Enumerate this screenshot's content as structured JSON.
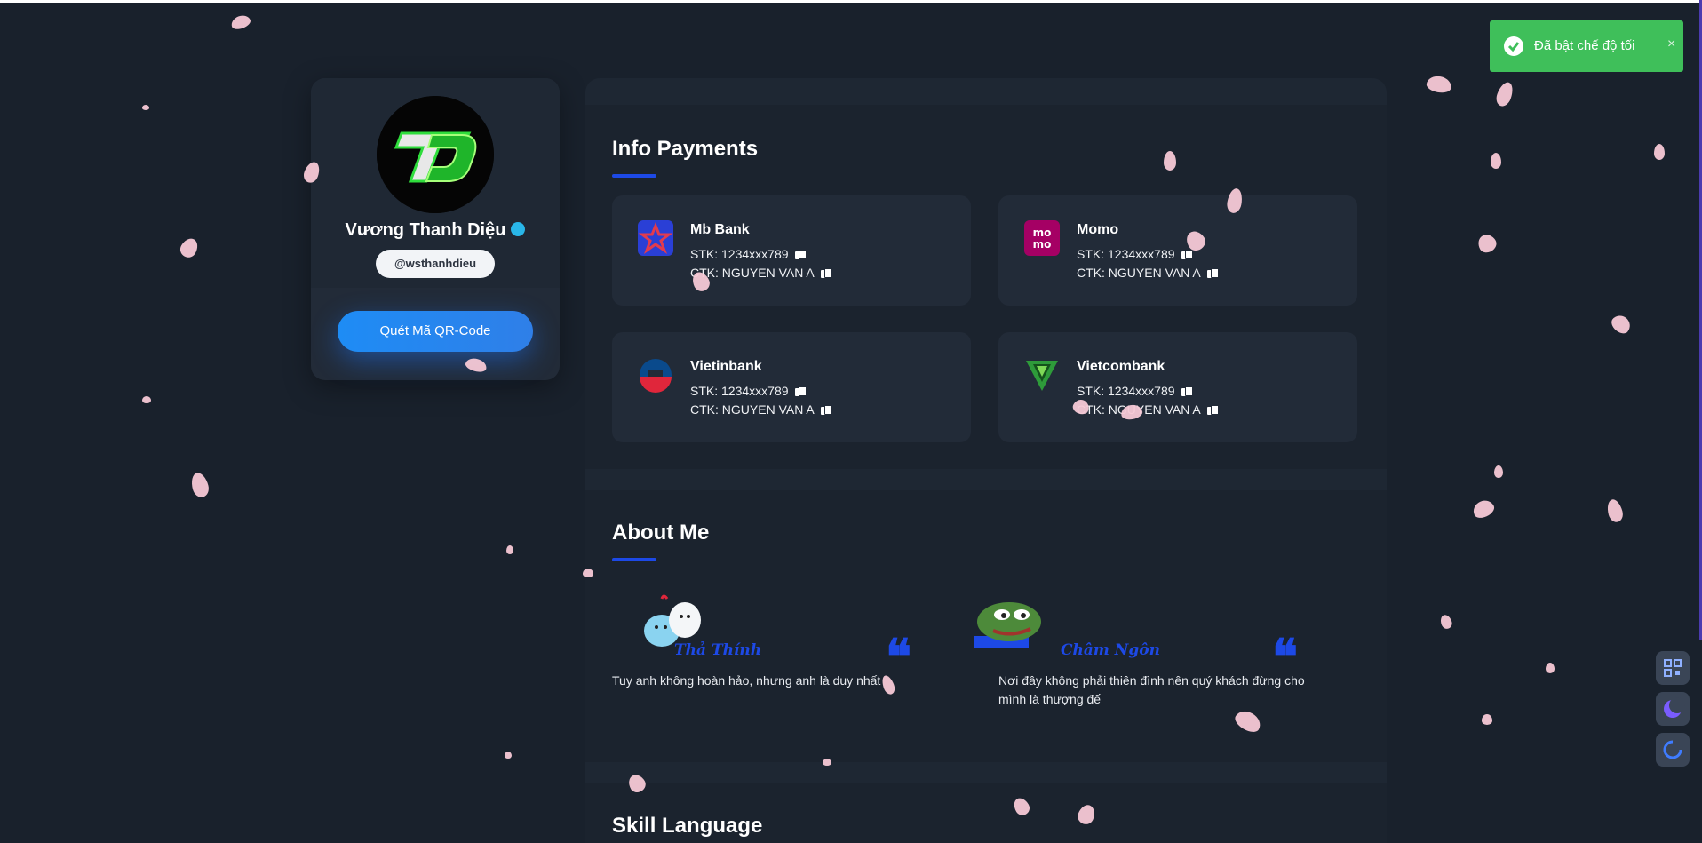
{
  "profile": {
    "name": "Vương Thanh Diệu",
    "handle": "@wsthanhdieu",
    "qr_button": "Quét Mã QR-Code"
  },
  "payments": {
    "title": "Info Payments",
    "cards": [
      {
        "bank": "Mb Bank",
        "stk": "STK: 1234xxx789",
        "ctk": "CTK: NGUYEN VAN A",
        "icon": "mb-bank-icon",
        "color": "#2a3fd6"
      },
      {
        "bank": "Momo",
        "stk": "STK: 1234xxx789",
        "ctk": "CTK: NGUYEN VAN A",
        "icon": "momo-icon",
        "color": "#a50064"
      },
      {
        "bank": "Vietinbank",
        "stk": "STK: 1234xxx789",
        "ctk": "CTK: NGUYEN VAN A",
        "icon": "vietinbank-icon",
        "color": "#0a4a8c"
      },
      {
        "bank": "Vietcombank",
        "stk": "STK: 1234xxx789",
        "ctk": "CTK: NGUYEN VAN A",
        "icon": "vietcombank-icon",
        "color": "#2e9b3a"
      }
    ]
  },
  "about": {
    "title": "About Me",
    "items": [
      {
        "category": "Thả Thính",
        "text": "Tuy anh không hoàn hảo, nhưng anh là duy nhất"
      },
      {
        "category": "Châm Ngôn",
        "text": "Nơi đây không phải thiên đình nên quý khách đừng cho mình là thượng đế"
      }
    ]
  },
  "skill": {
    "title": "Skill Language"
  },
  "toast": {
    "text": "Đã bật chế độ tối",
    "close": "×"
  },
  "colors": {
    "accent": "#1d49e6",
    "toast": "#3fbf5a",
    "background": "#19212c"
  },
  "quote_mark": "❝"
}
